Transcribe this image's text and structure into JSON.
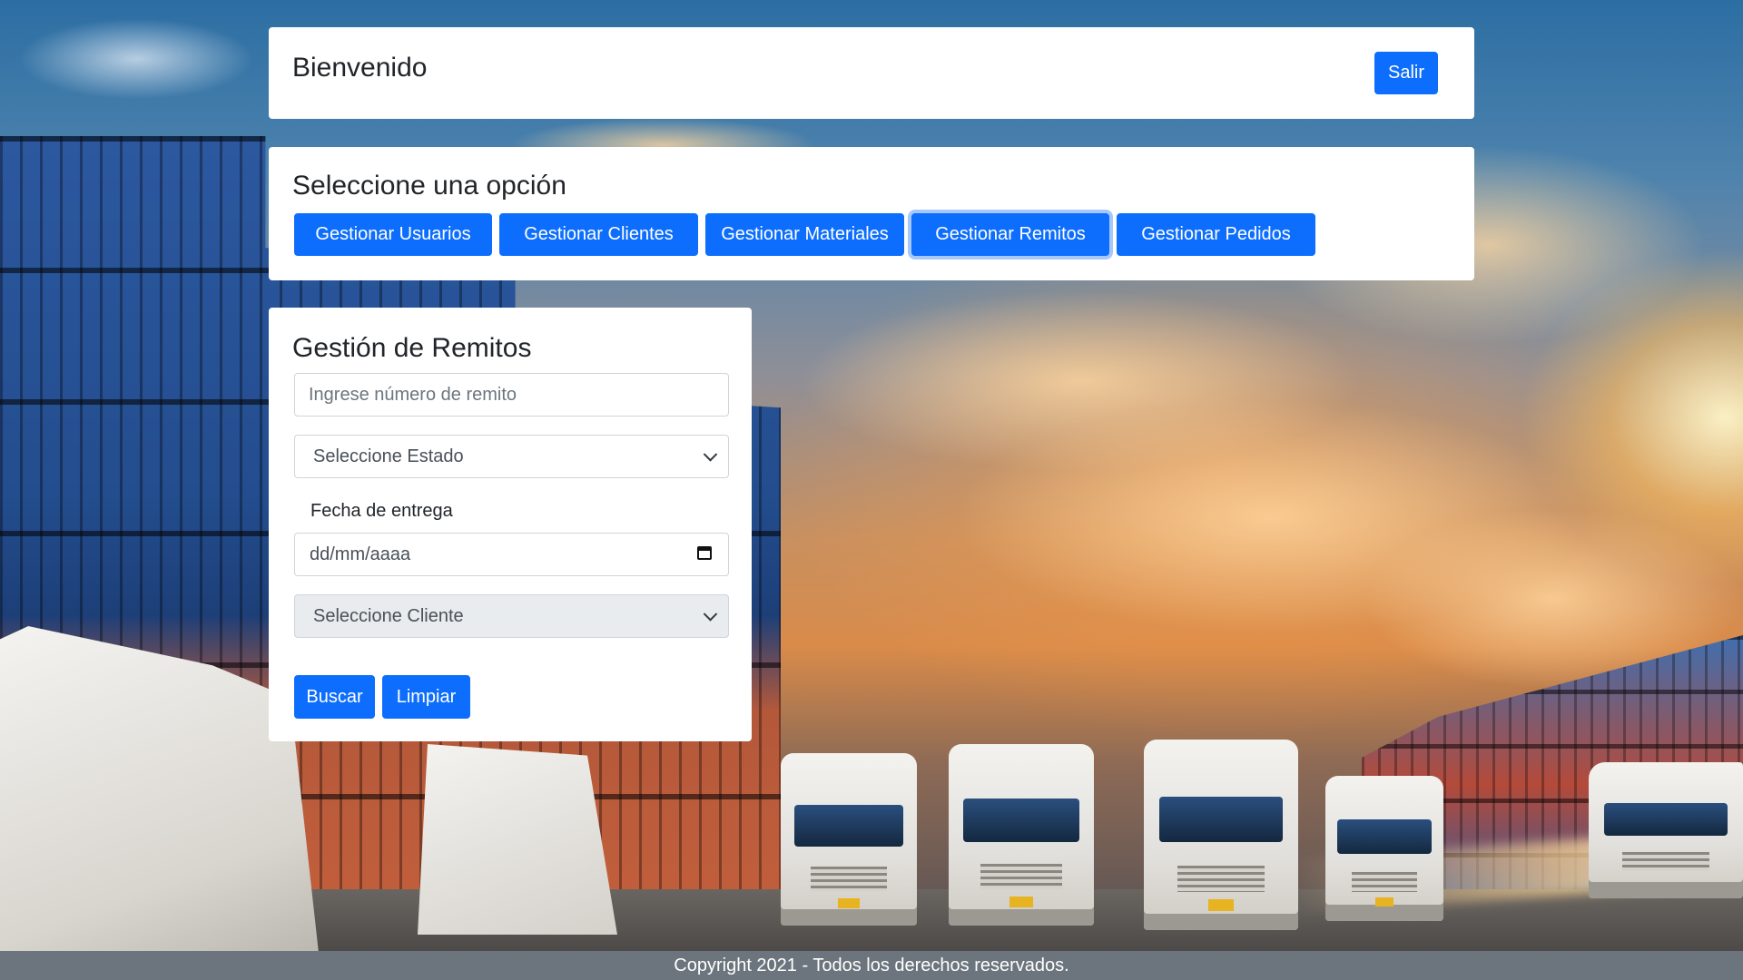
{
  "header": {
    "title": "Bienvenido",
    "logout_label": "Salir"
  },
  "menu": {
    "title": "Seleccione una opción",
    "buttons": [
      {
        "label": "Gestionar Usuarios"
      },
      {
        "label": "Gestionar Clientes"
      },
      {
        "label": "Gestionar Materiales"
      },
      {
        "label": "Gestionar Remitos",
        "active": true
      },
      {
        "label": "Gestionar Pedidos"
      }
    ]
  },
  "form": {
    "title": "Gestión de Remitos",
    "remito_placeholder": "Ingrese número de remito",
    "estado_select": "Seleccione Estado",
    "fecha_label": "Fecha de entrega",
    "fecha_value": "dd/mm/aaaa",
    "cliente_select": "Seleccione Cliente",
    "buscar_label": "Buscar",
    "limpiar_label": "Limpiar"
  },
  "footer": {
    "text": "Copyright 2021 - Todos los derechos reservados."
  },
  "colors": {
    "primary": "#0d6efd",
    "footer_bg": "#6c757d",
    "card_bg": "#ffffff"
  }
}
